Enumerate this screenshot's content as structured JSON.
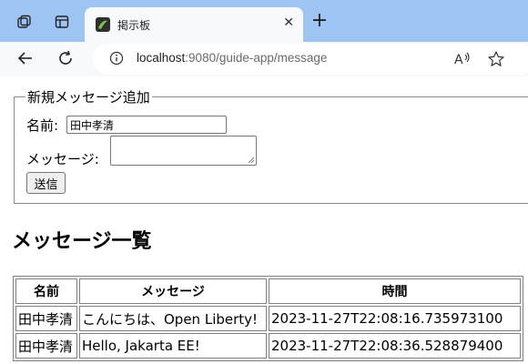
{
  "browser": {
    "tab": {
      "title": "掲示板",
      "close": "✕"
    },
    "new_tab": "+",
    "address": {
      "host": "localhost",
      "path": ":9080/guide-app/message"
    }
  },
  "form": {
    "legend": "新規メッセージ追加",
    "name_label": "名前:",
    "name_value": "田中孝清",
    "message_label": "メッセージ:",
    "message_value": "",
    "submit_label": "送信"
  },
  "list": {
    "heading": "メッセージ一覧",
    "columns": [
      "名前",
      "メッセージ",
      "時間"
    ],
    "rows": [
      [
        "田中孝清",
        "こんにちは、Open Liberty!",
        "2023-11-27T22:08:16.735973100"
      ],
      [
        "田中孝清",
        "Hello, Jakarta EE!",
        "2023-11-27T22:08:36.528879400"
      ]
    ]
  }
}
